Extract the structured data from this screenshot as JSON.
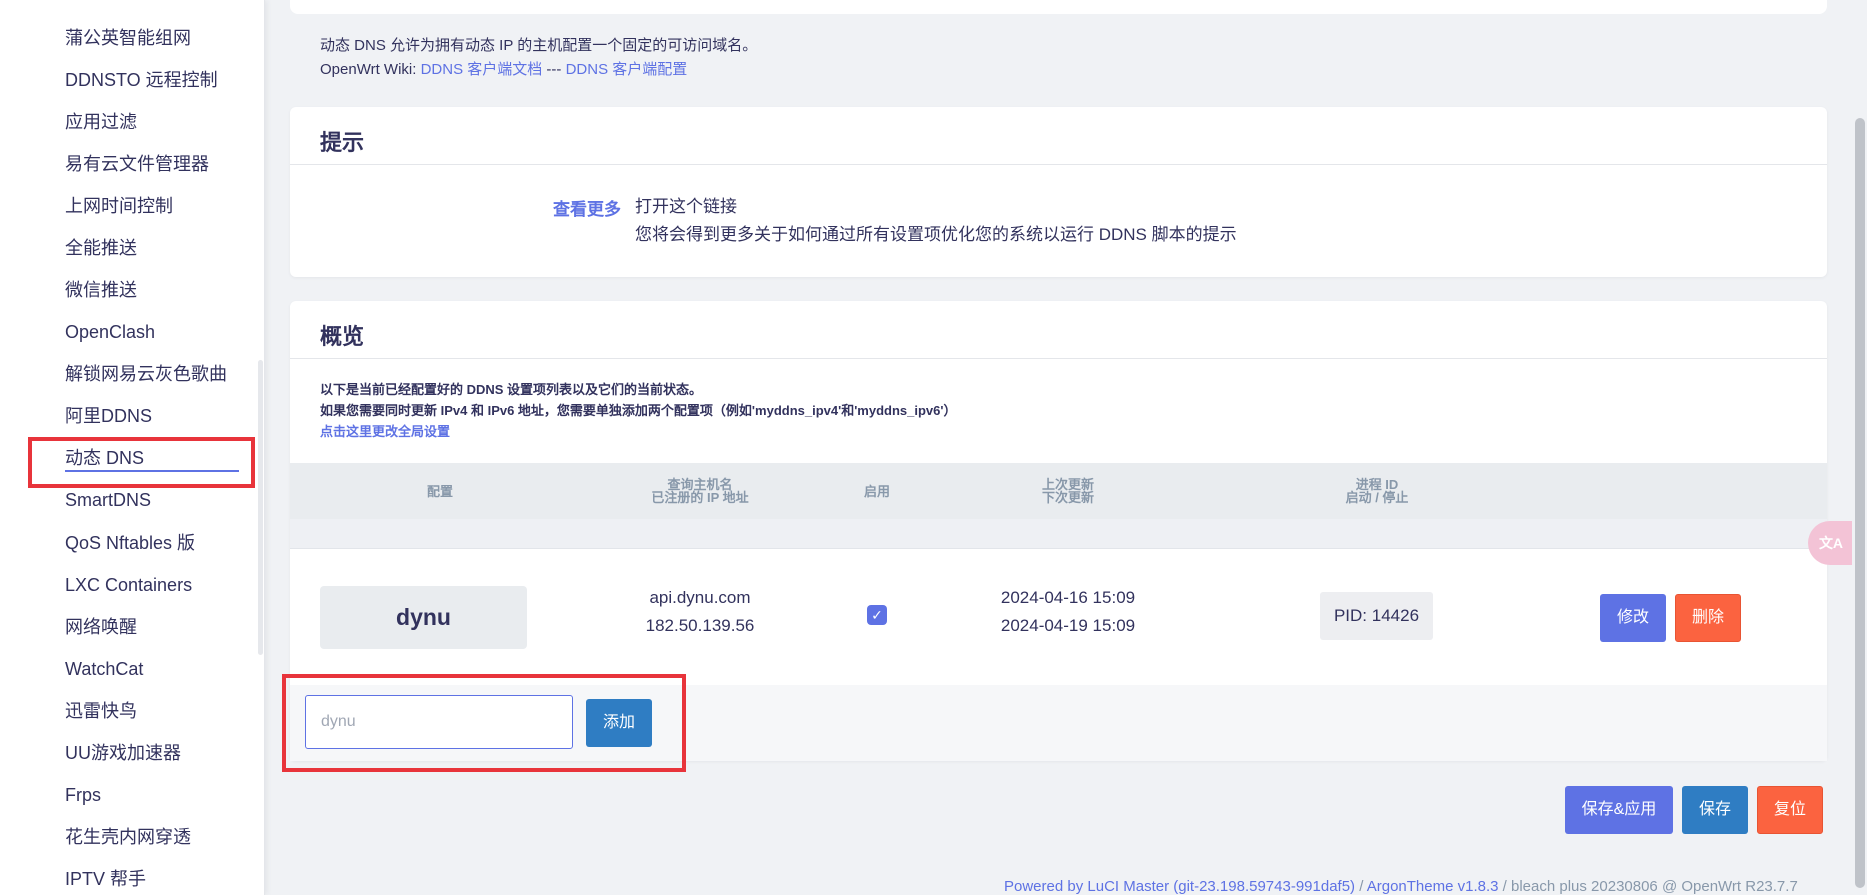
{
  "sidebar": {
    "items": [
      {
        "label": "蒲公英智能组网"
      },
      {
        "label": "DDNSTO 远程控制"
      },
      {
        "label": "应用过滤"
      },
      {
        "label": "易有云文件管理器"
      },
      {
        "label": "上网时间控制"
      },
      {
        "label": "全能推送"
      },
      {
        "label": "微信推送"
      },
      {
        "label": "OpenClash"
      },
      {
        "label": "解锁网易云灰色歌曲"
      },
      {
        "label": "阿里DDNS"
      },
      {
        "label": "动态 DNS",
        "active": true
      },
      {
        "label": "SmartDNS"
      },
      {
        "label": "QoS Nftables 版"
      },
      {
        "label": "LXC Containers"
      },
      {
        "label": "网络唤醒"
      },
      {
        "label": "WatchCat"
      },
      {
        "label": "迅雷快鸟"
      },
      {
        "label": "UU游戏加速器"
      },
      {
        "label": "Frps"
      },
      {
        "label": "花生壳内网穿透"
      },
      {
        "label": "IPTV 帮手"
      }
    ]
  },
  "intro": {
    "line1": "动态 DNS 允许为拥有动态 IP 的主机配置一个固定的可访问域名。",
    "wiki_prefix": "OpenWrt Wiki: ",
    "wiki_link1": "DDNS 客户端文档",
    "wiki_sep": " --- ",
    "wiki_link2": "DDNS 客户端配置"
  },
  "tips": {
    "title": "提示",
    "more_label": "查看更多",
    "line1": "打开这个链接",
    "line2": "您将会得到更多关于如何通过所有设置项优化您的系统以运行 DDNS 脚本的提示"
  },
  "overview": {
    "title": "概览",
    "desc1": "以下是当前已经配置好的 DDNS 设置项列表以及它们的当前状态。",
    "desc2": "如果您需要同时更新 IPv4 和 IPv6 地址，您需要单独添加两个配置项（例如'myddns_ipv4'和'myddns_ipv6'）",
    "global_link": "点击这里更改全局设置",
    "headers": {
      "config": "配置",
      "hostname_1": "查询主机名",
      "hostname_2": "已注册的 IP 地址",
      "enabled": "启用",
      "update_1": "上次更新",
      "update_2": "下次更新",
      "pid_1": "进程 ID",
      "pid_2": "启动 / 停止"
    },
    "rows": [
      {
        "name": "dynu",
        "hostname": "api.dynu.com",
        "ip": "182.50.139.56",
        "enabled": true,
        "check_mark": "✓",
        "last_update": "2024-04-16 15:09",
        "next_update": "2024-04-19 15:09",
        "pid": "PID: 14426",
        "edit_label": "修改",
        "delete_label": "删除"
      }
    ],
    "add": {
      "placeholder": "dynu",
      "value": "",
      "button_label": "添加"
    }
  },
  "actions": {
    "save_apply_label": "保存&应用",
    "save_label": "保存",
    "reset_label": "复位"
  },
  "footer": {
    "powered": "Powered by LuCI Master (git-23.198.59743-991daf5)",
    "sep1": " / ",
    "theme": "ArgonTheme v1.8.3",
    "rest": " / bleach plus 20230806 @ OpenWrt R23.7.7"
  },
  "translate_icon": {
    "glyph": "文A"
  },
  "colors": {
    "primary": "#5e72e4",
    "info": "#2f7dc3",
    "danger": "#fb6340",
    "highlight": "#e8343b"
  }
}
